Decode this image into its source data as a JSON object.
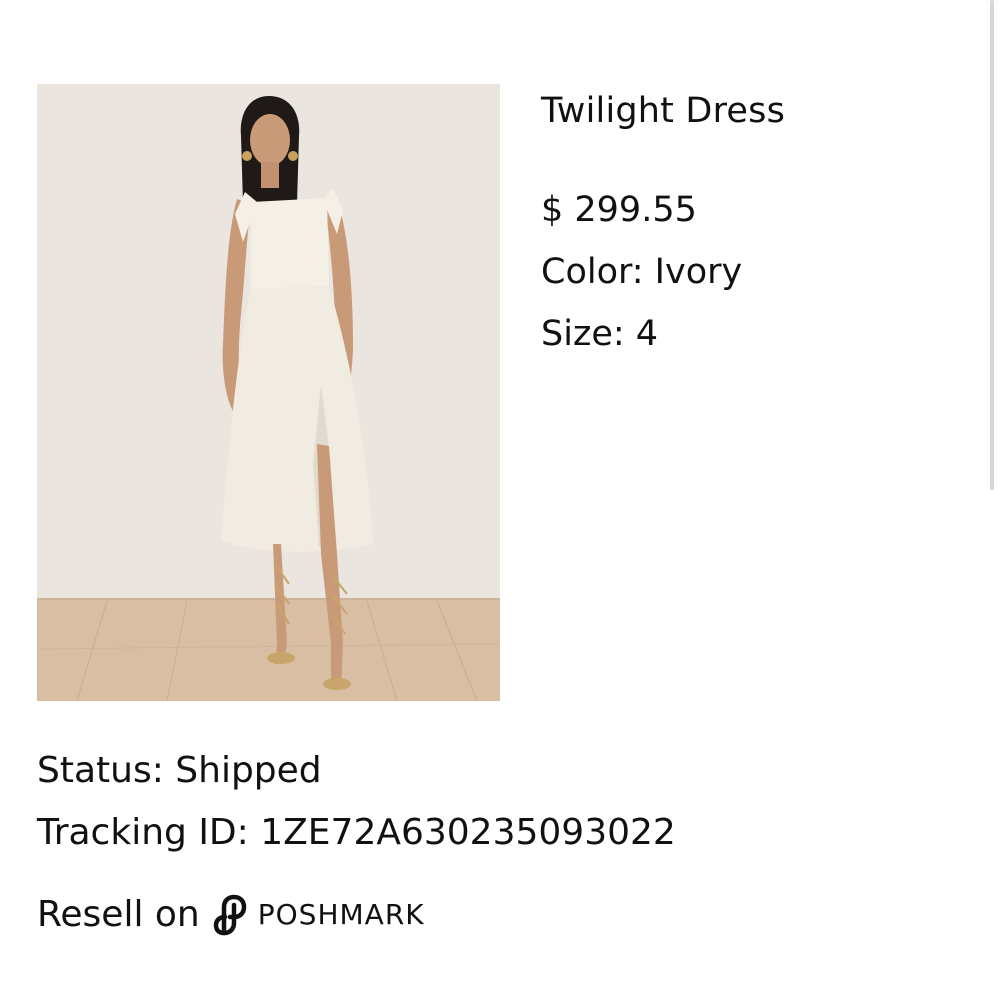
{
  "product": {
    "title": "Twilight Dress",
    "price": "$ 299.55",
    "color": "Color: Ivory",
    "size": "Size: 4"
  },
  "order": {
    "status": "Status: Shipped",
    "tracking": "Tracking ID: 1ZE72A630235093022"
  },
  "resell": {
    "label": "Resell on",
    "brand": "POSHMARK",
    "icon": "poshmark-logo-icon"
  },
  "colors": {
    "backdrop": "#ebe5df",
    "floor": "#d9bfa2",
    "dress": "#f4f0e6",
    "skin": "#c99a78",
    "hair": "#1f1a17"
  }
}
